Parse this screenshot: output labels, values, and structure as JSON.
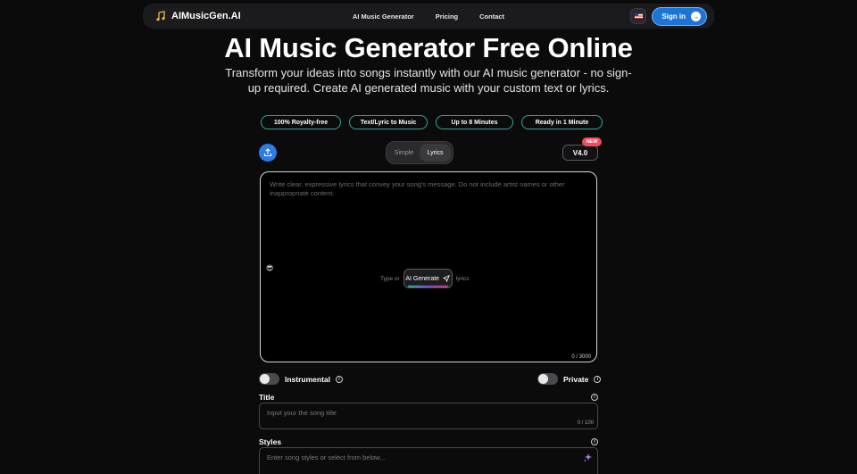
{
  "nav": {
    "brand": "AIMusicGen.AI",
    "links": [
      "AI Music Generator",
      "Pricing",
      "Contact"
    ],
    "signin": "Sign in"
  },
  "hero": {
    "title": "AI Music Generator Free Online",
    "subtitle": "Transform your ideas into songs instantly with our AI music generator - no sign-up required. Create AI generated music with your custom text or lyrics."
  },
  "badges": [
    "100% Royalty-free",
    "Text/Lyric to Music",
    "Up to 8 Minutes",
    "Ready in 1 Minute"
  ],
  "mode": {
    "options": [
      "Simple",
      "Lyrics"
    ],
    "selected": "Lyrics"
  },
  "version": {
    "label": "V4.0",
    "tag": "NEW"
  },
  "lyrics": {
    "placeholder": "Write clear, expressive lyrics that convey your song's message. Do not include artist names or other inappropriate content.",
    "emoji": "😎",
    "type_or": "Type or",
    "ai_generate": "AI Generate",
    "lyrics_word": "lyrics",
    "count": "0 / 3000"
  },
  "toggles": {
    "instrumental": "Instrumental",
    "private": "Private"
  },
  "title_field": {
    "label": "Title",
    "placeholder": "Input your the song title",
    "count": "0 / 100"
  },
  "styles_field": {
    "label": "Styles",
    "placeholder": "Enter song styles or select from below..."
  },
  "colors": {
    "accent": "#1d74d8",
    "badge_border": "#36a59a",
    "new_tag": "#ef4d5c"
  }
}
